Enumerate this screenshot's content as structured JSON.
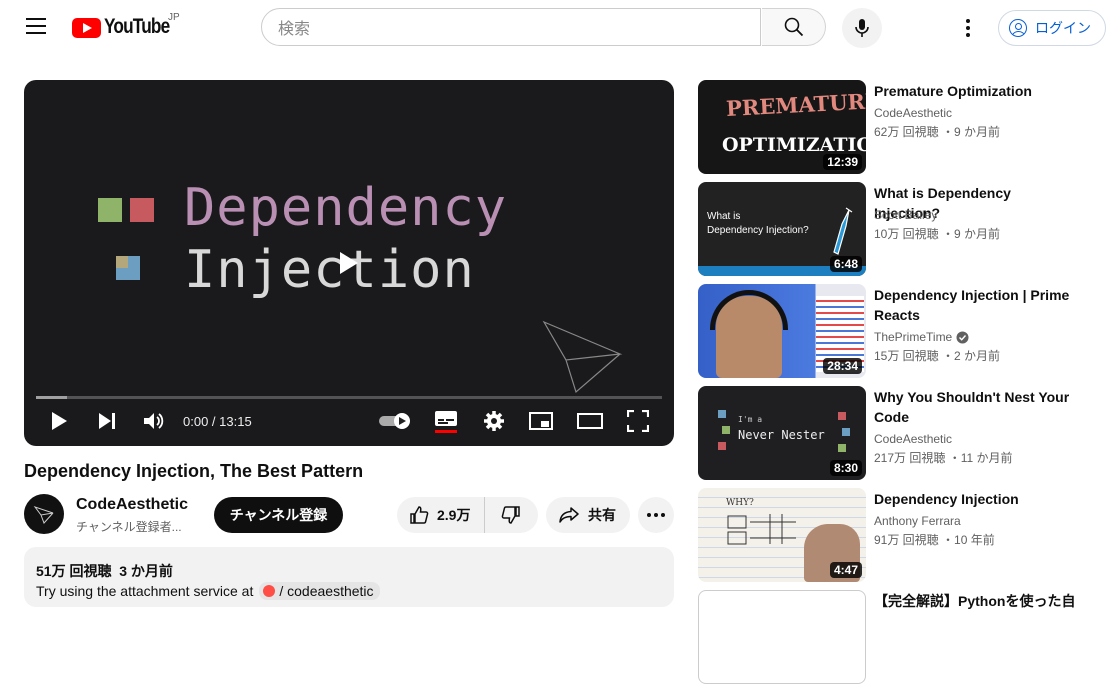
{
  "header": {
    "logo_text": "YouTube",
    "region": "JP",
    "search_placeholder": "検索",
    "login_label": "ログイン"
  },
  "player": {
    "title_line1": "Dependency",
    "title_line2": "Injection",
    "time_current": "0:00",
    "time_total": "13:15",
    "time_display": "0:00 / 13:15",
    "buffered_fraction": 0.05
  },
  "video": {
    "title": "Dependency Injection, The Best Pattern",
    "channel": "CodeAesthetic",
    "subscribers": "チャンネル登録者...",
    "subscribe_label": "チャンネル登録",
    "likes": "2.9万",
    "share_label": "共有",
    "views": "51万 回視聴",
    "age": "3 か月前",
    "desc_text": "Try using the attachment service at",
    "desc_link": "/ codeaesthetic"
  },
  "recommendations": [
    {
      "title": "Premature Optimization",
      "channel": "CodeAesthetic",
      "meta": "62万 回視聴 ・9 か月前",
      "duration": "12:39",
      "thumb_text1": "PREMATURE",
      "thumb_text2": "OPTIMIZATION",
      "verified": false
    },
    {
      "title": "What is Dependency Injection?",
      "channel": "Scott Bailey",
      "meta": "10万 回視聴 ・9 か月前",
      "duration": "6:48",
      "thumb_text1": "What is",
      "thumb_text2": "Dependency Injection?",
      "verified": false
    },
    {
      "title": "Dependency Injection | Prime Reacts",
      "channel": "ThePrimeTime",
      "meta": "15万 回視聴 ・2 か月前",
      "duration": "28:34",
      "verified": true
    },
    {
      "title": "Why You Shouldn't Nest Your Code",
      "channel": "CodeAesthetic",
      "meta": "217万 回視聴 ・11 か月前",
      "duration": "8:30",
      "thumb_text1": "I'm a",
      "thumb_text2": "Never Nester",
      "verified": false
    },
    {
      "title": "Dependency Injection",
      "channel": "Anthony Ferrara",
      "meta": "91万 回視聴 ・10 年前",
      "duration": "4:47",
      "thumb_text1": "WHY?",
      "verified": false
    },
    {
      "title": "【完全解説】Pythonを使った自"
    }
  ]
}
